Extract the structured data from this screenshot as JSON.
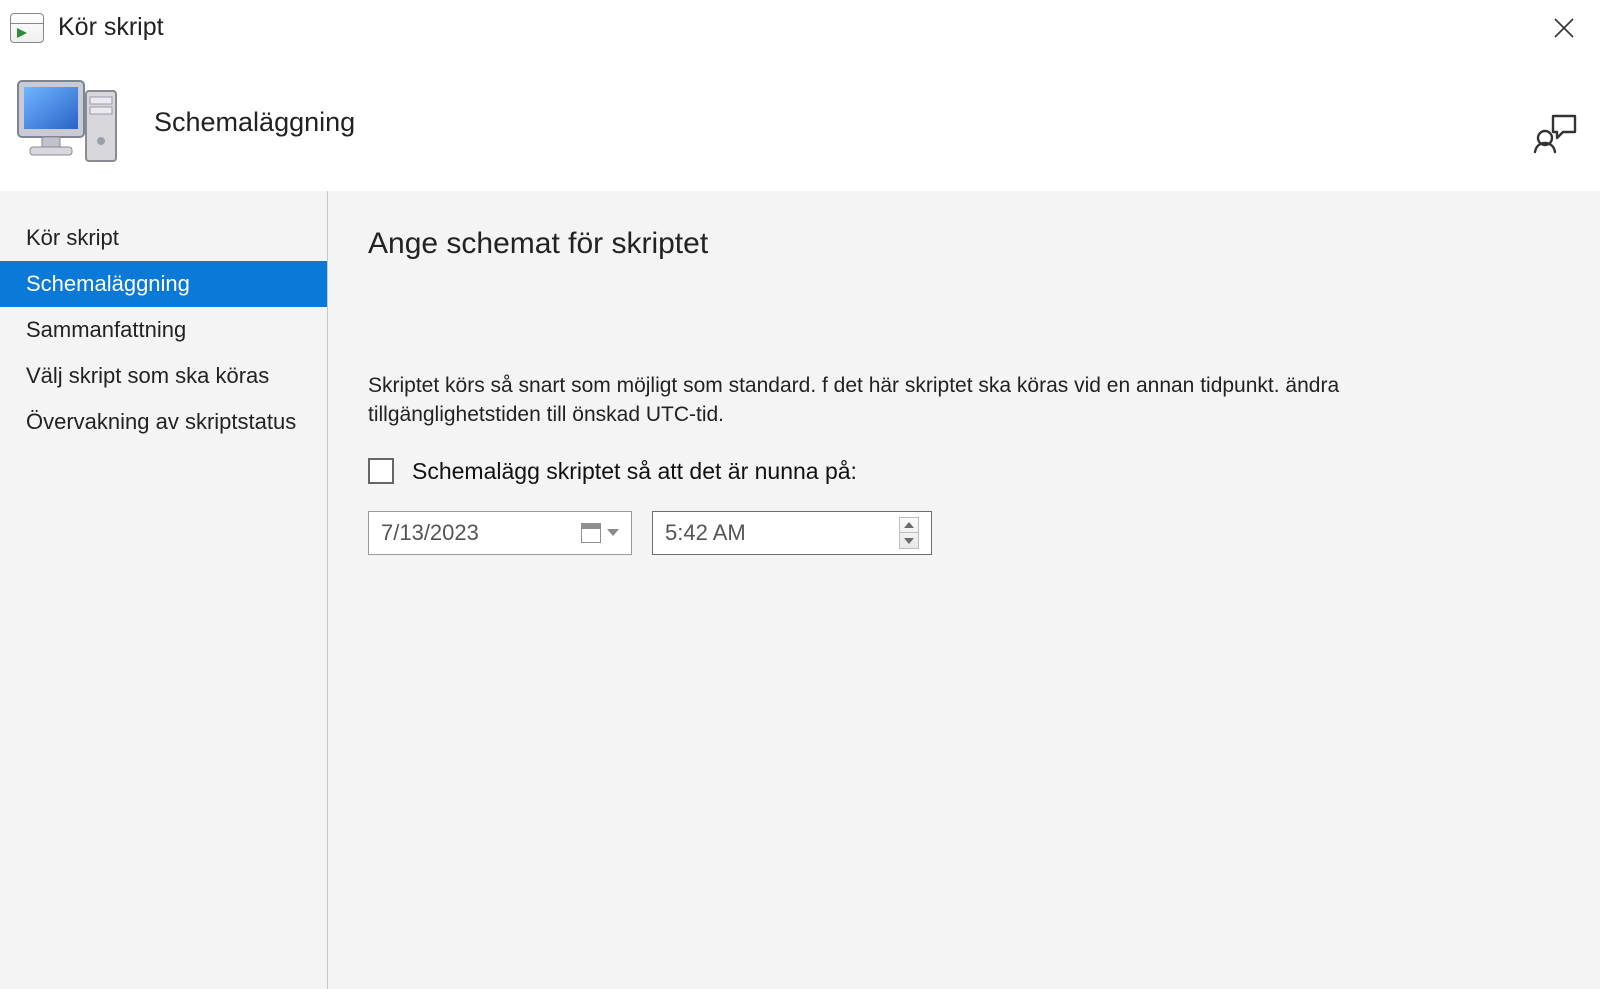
{
  "window": {
    "title": "Kör skript"
  },
  "header": {
    "page": "Schemaläggning"
  },
  "sidebar": {
    "items": [
      {
        "label": "Kör skript"
      },
      {
        "label": "Schemaläggning"
      },
      {
        "label": "Sammanfattning"
      },
      {
        "label": "Välj skript som ska köras"
      },
      {
        "label": "Övervakning av skriptstatus"
      }
    ],
    "selected_index": 1
  },
  "content": {
    "heading": "Ange schemat för skriptet",
    "description": "Skriptet körs så snart som möjligt som standard. f det här skriptet ska köras vid en annan tidpunkt. ändra tillgänglighetstiden till önskad UTC-tid.",
    "checkbox_label": "Schemalägg skriptet så att det är nunna på:",
    "checkbox_checked": false,
    "date_value": "7/13/2023",
    "time_value": "5:42 AM"
  }
}
